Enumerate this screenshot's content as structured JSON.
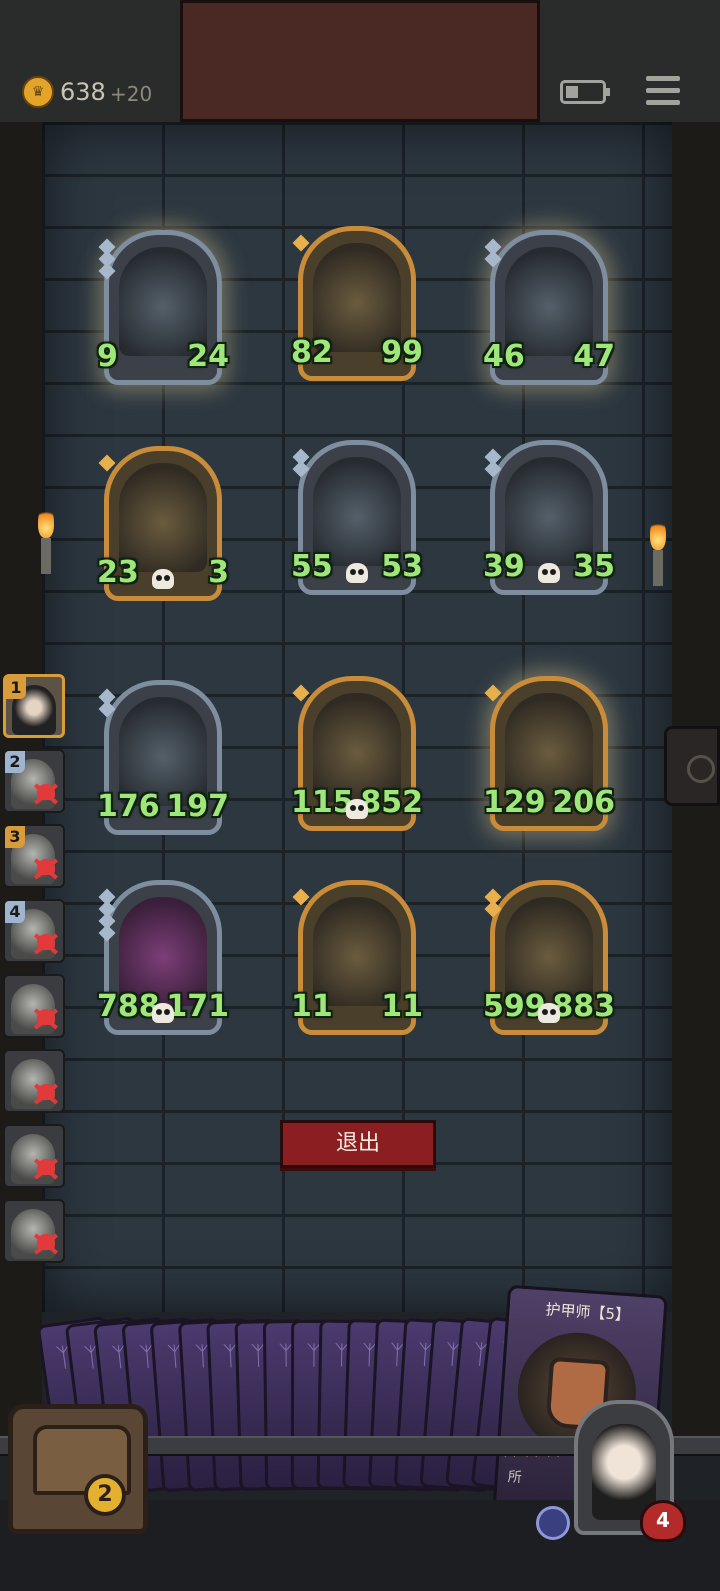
{
  "top_bar": {
    "coin_icon": "crown-coin-icon",
    "coins": "638",
    "coins_delta": "+20",
    "battery_icon": "battery-icon",
    "menu_icon": "hamburger-menu-icon"
  },
  "board": {
    "cards": [
      {
        "name": "clown-card",
        "frame": "silver",
        "attack": "9",
        "health": "24",
        "tier": 3,
        "skull": false,
        "glow": true
      },
      {
        "name": "sea-serpent-card",
        "frame": "gold",
        "attack": "82",
        "health": "99",
        "tier": 1,
        "skull": false,
        "glow": false
      },
      {
        "name": "rat-card",
        "frame": "silver",
        "attack": "46",
        "health": "47",
        "tier": 2,
        "skull": false,
        "glow": true
      },
      {
        "name": "robot-card",
        "frame": "gold",
        "attack": "23",
        "health": "3",
        "tier": 1,
        "skull": true,
        "glow": false
      },
      {
        "name": "gargoyle-card",
        "frame": "silver",
        "attack": "55",
        "health": "53",
        "tier": 2,
        "skull": true,
        "glow": false
      },
      {
        "name": "bomber-card",
        "frame": "silver",
        "attack": "39",
        "health": "35",
        "tier": 2,
        "skull": true,
        "glow": false
      },
      {
        "name": "bunny-mask-card",
        "frame": "silver",
        "attack": "176",
        "health": "197",
        "tier": 2,
        "skull": false,
        "glow": false
      },
      {
        "name": "witch-card",
        "frame": "gold",
        "attack": "115",
        "health": "852",
        "tier": 1,
        "skull": true,
        "glow": false
      },
      {
        "name": "elf-queen-card",
        "frame": "gold",
        "attack": "129",
        "health": "206",
        "tier": 1,
        "skull": false,
        "glow": true
      },
      {
        "name": "demon-bear-card",
        "frame": "silver",
        "attack": "788",
        "health": "171",
        "tier": 4,
        "skull": true,
        "glow": false,
        "purple": true
      },
      {
        "name": "fairy-card",
        "frame": "gold",
        "attack": "11",
        "health": "11",
        "tier": 1,
        "skull": false,
        "glow": false
      },
      {
        "name": "box-golem-card",
        "frame": "gold",
        "attack": "599",
        "health": "883",
        "tier": 2,
        "skull": true,
        "glow": false
      }
    ]
  },
  "roster": [
    {
      "num": "1",
      "active": true,
      "dead": false,
      "badge": "gold"
    },
    {
      "num": "2",
      "active": false,
      "dead": true,
      "badge": "silver"
    },
    {
      "num": "3",
      "active": false,
      "dead": true,
      "badge": "gold"
    },
    {
      "num": "4",
      "active": false,
      "dead": true,
      "badge": "silver"
    },
    {
      "num": "",
      "active": false,
      "dead": true,
      "badge": ""
    },
    {
      "num": "",
      "active": false,
      "dead": true,
      "badge": ""
    },
    {
      "num": "",
      "active": false,
      "dead": true,
      "badge": ""
    },
    {
      "num": "",
      "active": false,
      "dead": true,
      "badge": ""
    }
  ],
  "exit_button": "退出",
  "hand": {
    "feature_card_title": "护甲师【5】",
    "feature_card_text": "所",
    "stars": "★★★"
  },
  "chest": {
    "count": "2"
  },
  "hero": {
    "health": "4"
  }
}
